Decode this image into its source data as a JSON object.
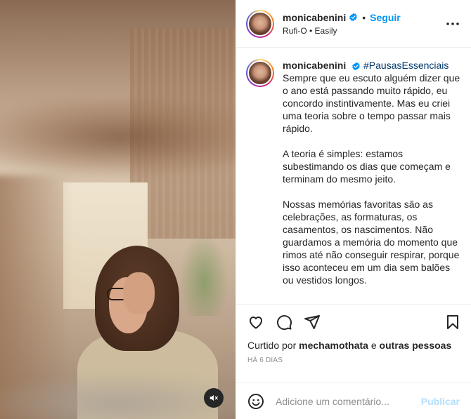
{
  "post": {
    "username": "monicabenini",
    "follow_label": "Seguir",
    "separator": "•",
    "audio": "Rufi-O • Easily",
    "caption_username": "monicabenini",
    "hashtag": "#PausasEssenciais",
    "caption_p1": "Sempre que eu escuto alguém dizer que o ano está passando muito rápido, eu concordo instintivamente. Mas eu criei uma teoria sobre o tempo passar mais rápido.",
    "caption_p2": "A teoria é simples: estamos subestimando os dias que começam e terminam do mesmo jeito.",
    "caption_p3": "Nossas memórias favoritas são as celebrações, as formaturas, os casamentos, os nascimentos. Não guardamos a memória do momento que rimos até não conseguir respirar, porque isso aconteceu em um dia sem balões ou vestidos longos.",
    "likes_prefix": "Curtido por",
    "likes_user": "mechamothata",
    "likes_connector": "e",
    "likes_others": "outras pessoas",
    "time_ago": "HÁ 6 DIAS"
  },
  "comment": {
    "placeholder": "Adicione um comentário...",
    "publish_label": "Publicar"
  },
  "colors": {
    "accent": "#0095f6",
    "hashtag": "#00376b",
    "publish_disabled": "#b2dffc",
    "muted": "#8e8e8e"
  },
  "icons": {
    "header_more": "more-options-icon",
    "verified": "verified-badge-icon",
    "like": "heart-icon",
    "comment": "comment-icon",
    "share": "share-icon",
    "save": "bookmark-icon",
    "emoji": "emoji-icon",
    "mute": "audio-muted-icon"
  }
}
